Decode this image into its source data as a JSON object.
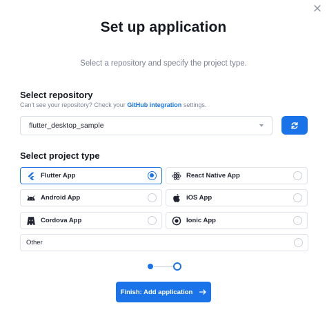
{
  "header": {
    "title": "Set up application",
    "subtitle": "Select a repository and specify the project type."
  },
  "repository": {
    "heading": "Select repository",
    "helper_prefix": "Can't see your repository? Check your",
    "helper_link": "GitHub integration",
    "helper_suffix": "settings.",
    "selected_value": "flutter_desktop_sample"
  },
  "project_type": {
    "heading": "Select project type",
    "options": [
      {
        "label": "Flutter App",
        "icon": "flutter-icon",
        "selected": true
      },
      {
        "label": "React Native App",
        "icon": "react-icon",
        "selected": false
      },
      {
        "label": "Android App",
        "icon": "android-icon",
        "selected": false
      },
      {
        "label": "iOS App",
        "icon": "apple-icon",
        "selected": false
      },
      {
        "label": "Cordova App",
        "icon": "cordova-icon",
        "selected": false
      },
      {
        "label": "Ionic App",
        "icon": "ionic-icon",
        "selected": false
      },
      {
        "label": "Other",
        "icon": "",
        "selected": false
      }
    ]
  },
  "stepper": {
    "current_step": 2,
    "total_steps": 2
  },
  "footer": {
    "finish_label": "Finish: Add application"
  },
  "colors": {
    "accent": "#1a73e8",
    "text": "#1f2330",
    "muted": "#7b8394",
    "border": "#dfe2e8"
  }
}
